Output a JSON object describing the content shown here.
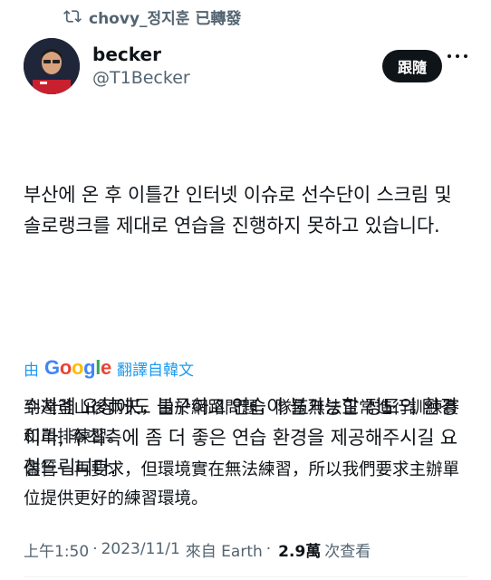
{
  "repost": {
    "icon": "repost-icon",
    "label": "chovy_정지훈 已轉發"
  },
  "author": {
    "display_name": "becker",
    "handle": "@T1Becker",
    "avatar_icon": "avatar",
    "follow_label": "跟隨",
    "more_icon": "more-icon"
  },
  "tweet": {
    "paragraph1": "부산에 온 후 이틀간 인터넷 이슈로 선수단이 스크림 및 솔로랭크를 제대로 연습을 진행하지 못하고 있습니다.",
    "paragraph2": "수차례 요청에도 불구하고 연습이 불가능할 정도의 환경이라, 주최측에 좀 더 좋은 연습 환경을 제공해주시길 요청드립니다."
  },
  "translation": {
    "prefix": "由",
    "google": "Google",
    "suffix": "翻譯自韓文",
    "paragraph1": "到達釜山後兩天，由於網路問題，隊伍無法正常進行訓練賽和單排練習。",
    "paragraph2": "儘管一再要求，但環境實在無法練習，所以我們要求主辦單位提供更好的練習環境。"
  },
  "meta": {
    "time": "上午1:50",
    "sep1": "·",
    "date": "2023/11/1",
    "source": "來自 Earth",
    "sep2": "·",
    "views": "2.9萬",
    "views_label": "次查看"
  },
  "colors": {
    "text": "#0f1419",
    "secondary": "#536471",
    "link": "#1d9bf0",
    "google_blue": "#4285f4",
    "google_red": "#ea4335",
    "google_yellow": "#fbbc05",
    "google_green": "#34a853"
  }
}
